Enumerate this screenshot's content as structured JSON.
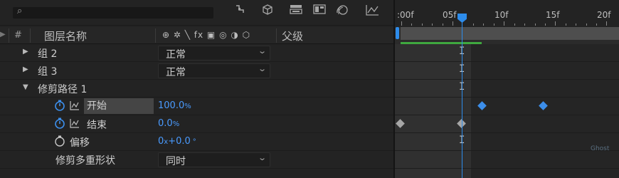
{
  "toolbar": {
    "search_glyph": "⌕",
    "icons": [
      "track-icon",
      "3d-layer-icon",
      "comp-flowchart-icon",
      "frame-blend-icon",
      "motion-blur-icon",
      "graph-editor-icon"
    ]
  },
  "columns": {
    "hash": "#",
    "layer_name": "图层名称",
    "switches": "⊕ ✲ ╲ fx ▣ ◎ ◑ ⬡",
    "parent": "父级"
  },
  "rows": [
    {
      "name": "组 2",
      "type": "group",
      "dropdown": "正常"
    },
    {
      "name": "组 3",
      "type": "group",
      "dropdown": "正常"
    },
    {
      "name": "修剪路径 1",
      "type": "effect"
    },
    {
      "name": "开始",
      "type": "property",
      "value": "100.0",
      "unit": "%"
    },
    {
      "name": "结束",
      "type": "property",
      "value": "0.0",
      "unit": "%"
    },
    {
      "name": "偏移",
      "type": "property",
      "value_rev": "0",
      "value_x": "x",
      "value_deg": "+0.0",
      "unit": "°"
    },
    {
      "name": "修剪多重形状",
      "type": "option",
      "dropdown": "同时"
    }
  ],
  "timeline": {
    "labels": [
      ":00f",
      "05f",
      "10f",
      "15f",
      "20f"
    ]
  },
  "watermark": "Ghost"
}
